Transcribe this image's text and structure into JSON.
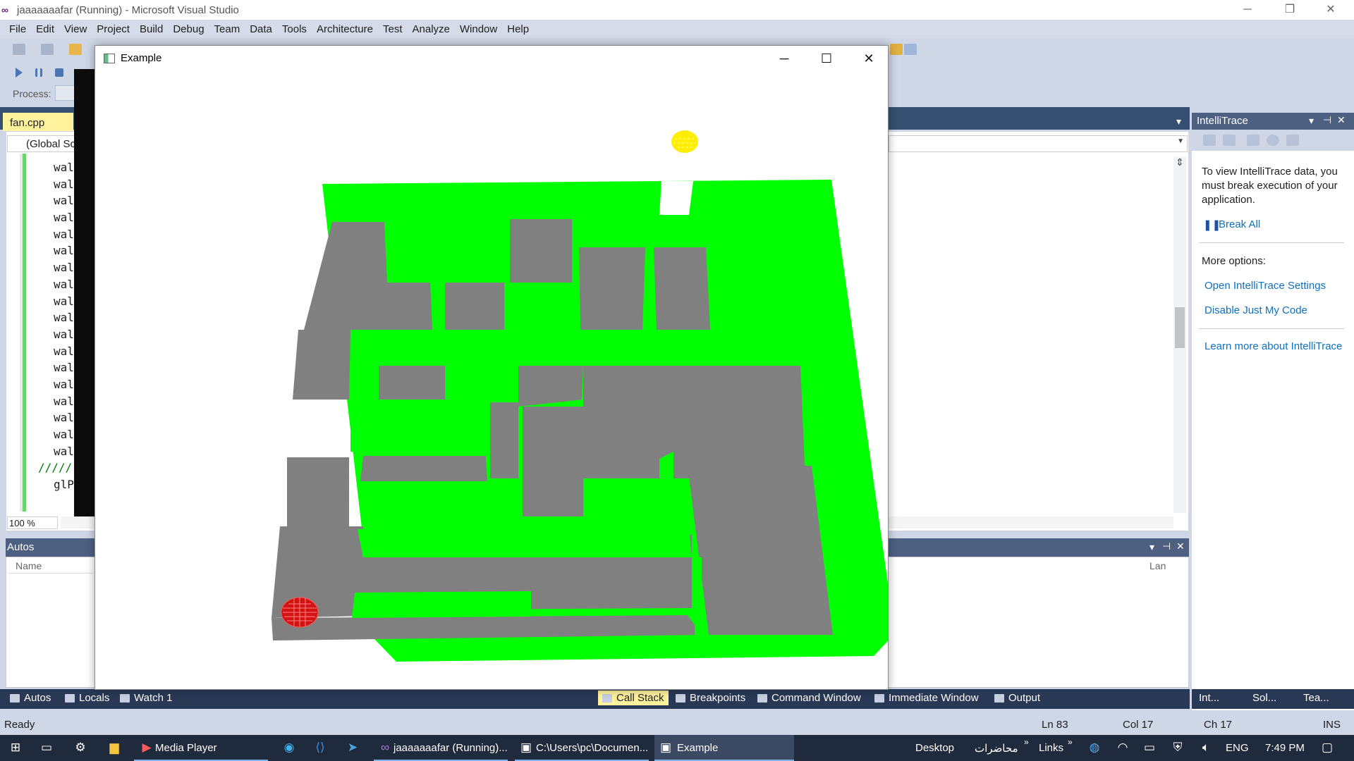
{
  "vs": {
    "title": "jaaaaaaafar (Running) - Microsoft Visual Studio",
    "menu": [
      "File",
      "Edit",
      "View",
      "Project",
      "Build",
      "Debug",
      "Team",
      "Data",
      "Tools",
      "Architecture",
      "Test",
      "Analyze",
      "Window",
      "Help"
    ],
    "process_label": "Process:",
    "doc_tab": "fan.cpp",
    "scope_dropdown": "(Global Sc",
    "code_lines": [
      "wal",
      "wal",
      "wal",
      "wal",
      "wal",
      "wal",
      "wal",
      "wal",
      "wal",
      "wal",
      "wal",
      "wal",
      "wal",
      "wal",
      "wal",
      "wal",
      "wal",
      "wal",
      "/////",
      "glP"
    ],
    "zoom": "100 %",
    "autos": {
      "title": "Autos",
      "col_name": "Name",
      "col_lang": "Lan"
    },
    "bottom_tabs": [
      "Autos",
      "Locals",
      "Watch 1"
    ],
    "debug_tabs": [
      "Call Stack",
      "Breakpoints",
      "Command Window",
      "Immediate Window",
      "Output"
    ],
    "intellitrace": {
      "title": "IntelliTrace",
      "message": "To view IntelliTrace data, you must break execution of your application.",
      "break_all": "Break All",
      "more_options": "More options:",
      "open_settings": "Open IntelliTrace Settings",
      "disable_jmc": "Disable Just My Code",
      "learn_more": "Learn more about IntelliTrace",
      "tabs": [
        "Int...",
        "Sol...",
        "Tea..."
      ]
    },
    "status": {
      "ready": "Ready",
      "ln": "Ln 83",
      "col": "Col 17",
      "ch": "Ch 17",
      "ins": "INS"
    }
  },
  "example_window": {
    "title": "Example",
    "colors": {
      "wall_green": "#00ff00",
      "floor_gray": "#808080",
      "player_red": "#e00000",
      "sun_yellow": "#ffee00"
    }
  },
  "taskbar": {
    "media_player": "Media Player",
    "vs_running": "jaaaaaaafar (Running)...",
    "console": "C:\\Users\\pc\\Documen...",
    "example": "Example",
    "desktop": "Desktop",
    "lectures": "محاضرات",
    "links": "Links",
    "language": "ENG",
    "time": "7:49 PM"
  }
}
